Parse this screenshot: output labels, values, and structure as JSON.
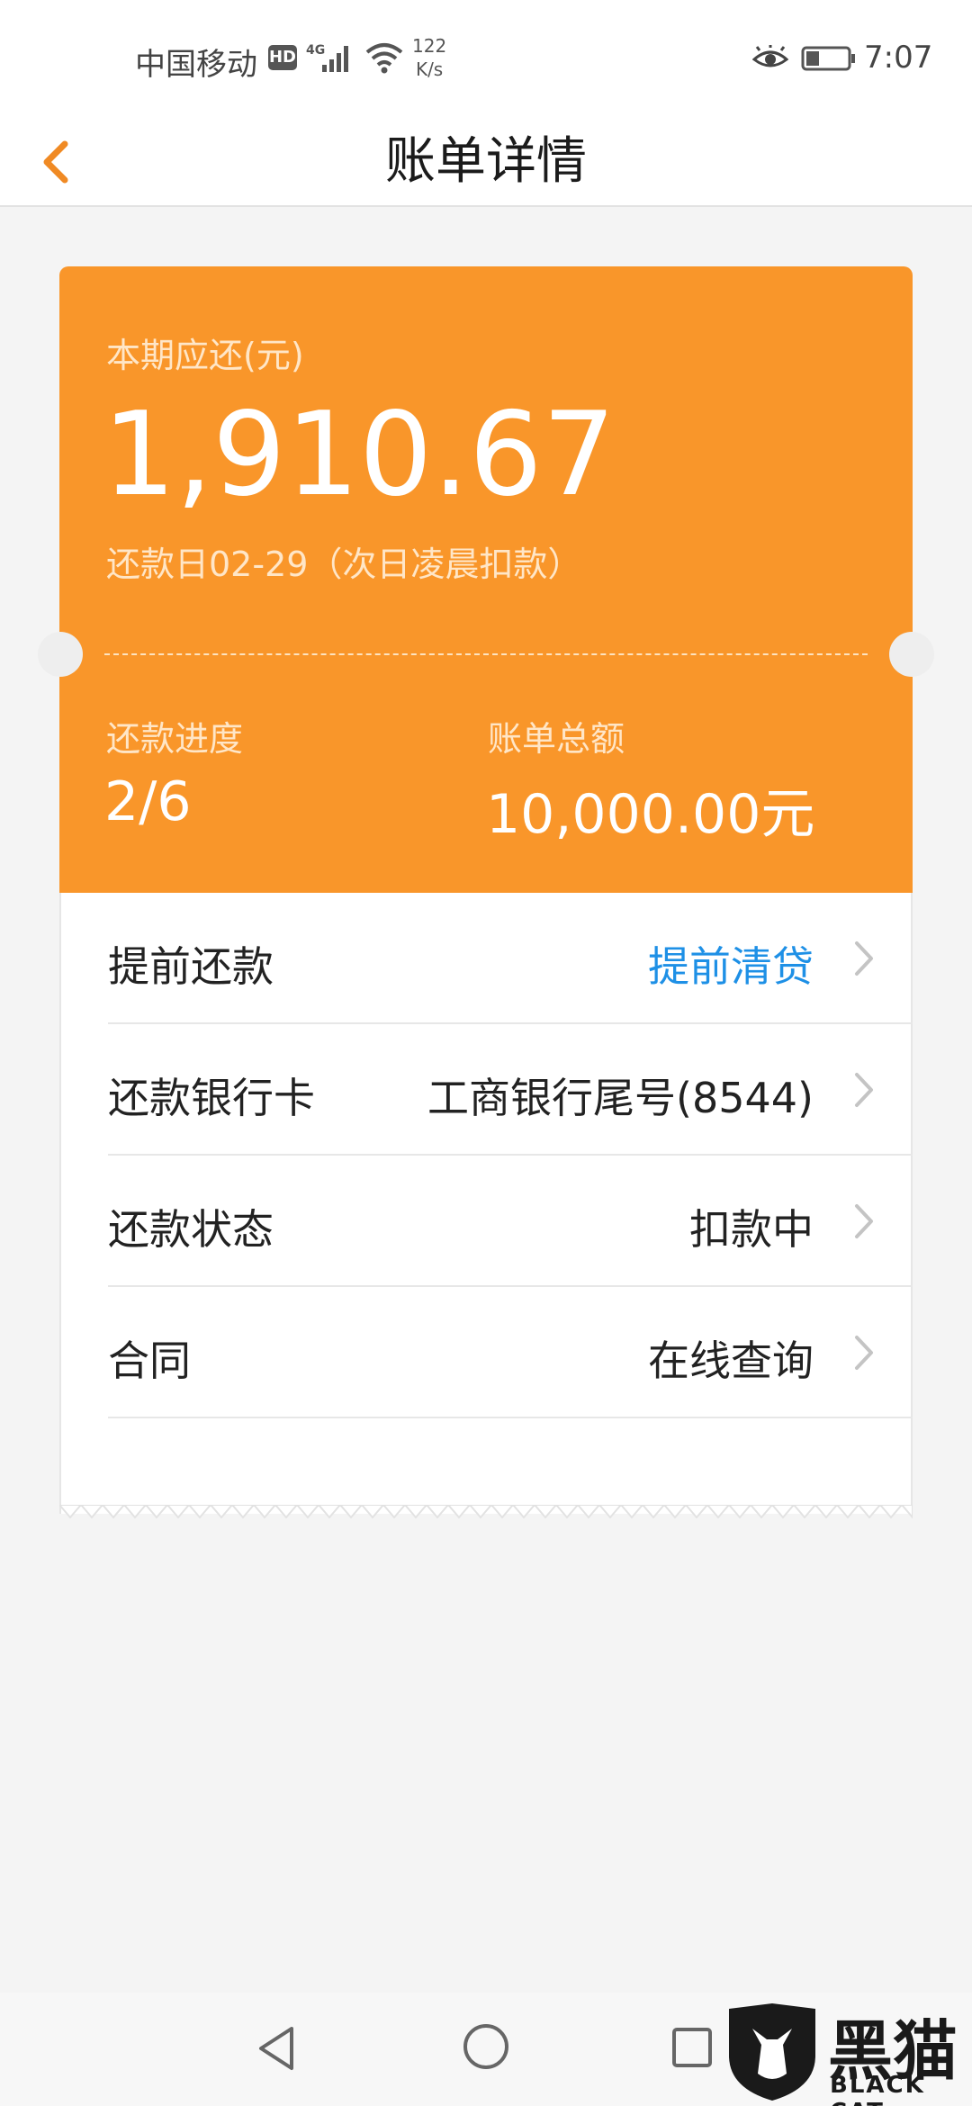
{
  "status_bar": {
    "carrier": "中国移动",
    "hd": "HD",
    "network": "4G",
    "speed_value": "122",
    "speed_unit": "K/s",
    "time": "7:07"
  },
  "header": {
    "title": "账单详情",
    "back_icon": "chevron-left-icon",
    "accent_color": "#f08a24"
  },
  "bill": {
    "due_label": "本期应还(元)",
    "due_amount": "1,910.67",
    "due_date": "还款日02-29（次日凌晨扣款）",
    "progress_label": "还款进度",
    "progress_value": "2/6",
    "total_label": "账单总额",
    "total_value": "10,000.00元",
    "card_color": "#f9962a"
  },
  "rows": [
    {
      "label": "提前还款",
      "value": "提前清贷",
      "value_color": "#1e90e6"
    },
    {
      "label": "还款银行卡",
      "value": "工商银行尾号(8544)"
    },
    {
      "label": "还款状态",
      "value": "扣款中"
    },
    {
      "label": "合同",
      "value": "在线查询"
    }
  ],
  "watermark": {
    "text": "黑猫",
    "subtext": "BLACK CAT"
  }
}
